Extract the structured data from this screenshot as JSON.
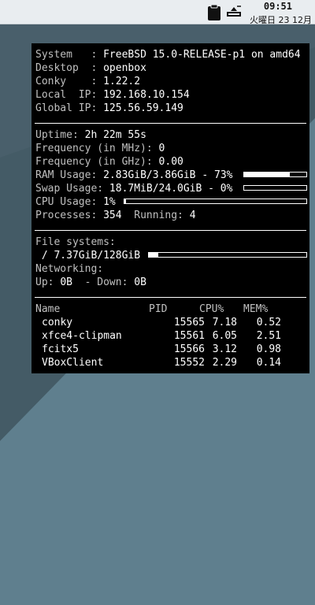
{
  "panel": {
    "time": "09:51",
    "date": "火曜日 23 12月"
  },
  "system": {
    "system_label": "System",
    "system_value": "FreeBSD 15.0-RELEASE-p1 on amd64",
    "desktop_label": "Desktop",
    "desktop_value": "openbox",
    "conky_label": "Conky",
    "conky_value": "1.22.2",
    "local_ip_label": "Local  IP:",
    "local_ip_value": "192.168.10.154",
    "global_ip_label": "Global IP:",
    "global_ip_value": "125.56.59.149"
  },
  "stats": {
    "uptime_label": "Uptime:",
    "uptime_value": "2h 22m 55s",
    "freq_mhz_label": "Frequency (in MHz):",
    "freq_mhz_value": "0",
    "freq_ghz_label": "Frequency (in GHz):",
    "freq_ghz_value": "0.00",
    "ram_label": "RAM Usage:",
    "ram_value": "2.83GiB/3.86GiB - 73%",
    "ram_fraction": 0.73,
    "swap_label": "Swap Usage:",
    "swap_value": "18.7MiB/24.0GiB - 0%",
    "swap_fraction": 0.0,
    "cpu_label": "CPU Usage:",
    "cpu_value": "1%",
    "cpu_fraction": 0.01,
    "processes_label": "Processes:",
    "processes_value": "354",
    "running_label": "Running:",
    "running_value": "4"
  },
  "storage": {
    "fs_heading": "File systems:",
    "root_prefix": "/",
    "root_value": "7.37GiB/128GiB",
    "root_fraction": 0.058,
    "net_heading": "Networking:",
    "up_label": "Up:",
    "up_value": "0B",
    "down_label": "- Down:",
    "down_value": "0B"
  },
  "processes": {
    "headers": {
      "name": "Name",
      "pid": "PID",
      "cpu": "CPU%",
      "mem": "MEM%"
    },
    "rows": [
      {
        "name": "conky",
        "pid": "15565",
        "cpu": "7.18",
        "mem": "0.52"
      },
      {
        "name": "xfce4-clipman",
        "pid": "15561",
        "cpu": "6.05",
        "mem": "2.51"
      },
      {
        "name": "fcitx5",
        "pid": "15566",
        "cpu": "3.12",
        "mem": "0.98"
      },
      {
        "name": "VBoxClient",
        "pid": "15552",
        "cpu": "2.29",
        "mem": "0.14"
      }
    ]
  },
  "icons": {
    "clipboard": "clipboard-icon",
    "eject": "removable-drive-icon"
  },
  "colors": {
    "conky_bg": "#000000",
    "label": "#c0c0c0",
    "value": "#ffffff",
    "panel_bg": "#e9edf0",
    "wallpaper_light": "#5d7d8c",
    "wallpaper_dark": "#3a4e57"
  }
}
